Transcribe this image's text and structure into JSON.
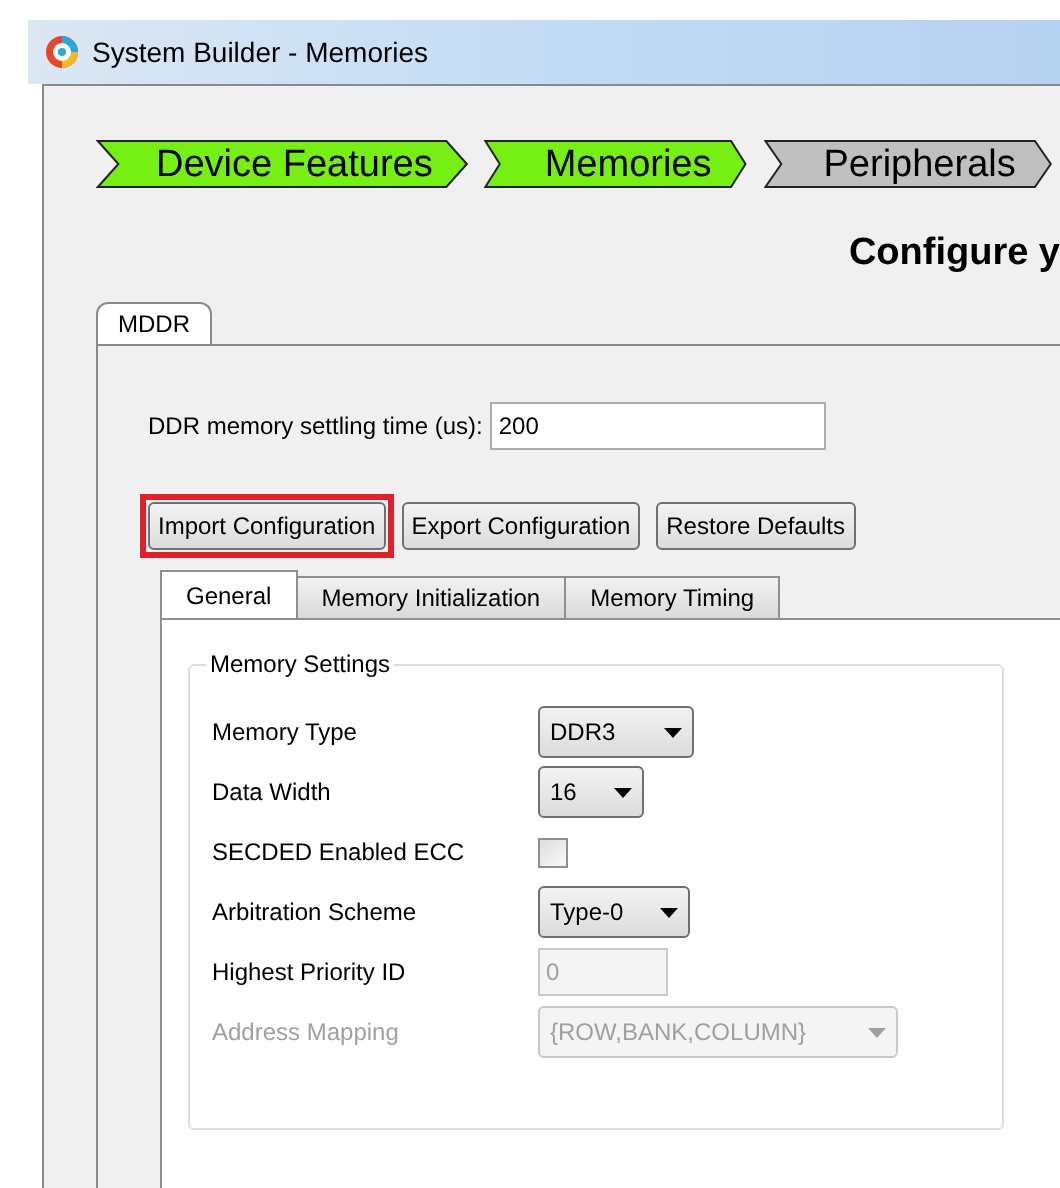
{
  "window": {
    "title": "System Builder - Memories"
  },
  "steps": [
    {
      "label": "Device Features",
      "done": true
    },
    {
      "label": "Memories",
      "done": true
    },
    {
      "label": "Peripherals",
      "done": false
    }
  ],
  "heading": "Configure y",
  "outer_tabs": [
    {
      "label": "MDDR",
      "selected": true
    }
  ],
  "settling": {
    "label": "DDR memory settling time (us):",
    "value": "200"
  },
  "buttons": [
    {
      "label": "Import Configuration",
      "highlighted": true
    },
    {
      "label": "Export Configuration",
      "highlighted": false
    },
    {
      "label": "Restore Defaults",
      "highlighted": false
    }
  ],
  "inner_tabs": [
    {
      "label": "General",
      "selected": true
    },
    {
      "label": "Memory Initialization",
      "selected": false
    },
    {
      "label": "Memory Timing",
      "selected": false
    }
  ],
  "group": {
    "title": "Memory Settings",
    "rows": [
      {
        "label": "Memory Type",
        "kind": "select",
        "value": "DDR3",
        "disabled": false
      },
      {
        "label": "Data Width",
        "kind": "select",
        "value": "16",
        "disabled": false
      },
      {
        "label": "SECDED Enabled ECC",
        "kind": "checkbox",
        "checked": false,
        "disabled": false
      },
      {
        "label": "Arbitration Scheme",
        "kind": "select",
        "value": "Type-0",
        "disabled": false
      },
      {
        "label": "Highest Priority ID",
        "kind": "text",
        "value": "0",
        "disabled": true
      },
      {
        "label": "Address Mapping",
        "kind": "select",
        "value": "{ROW,BANK,COLUMN}",
        "disabled": true
      }
    ]
  }
}
